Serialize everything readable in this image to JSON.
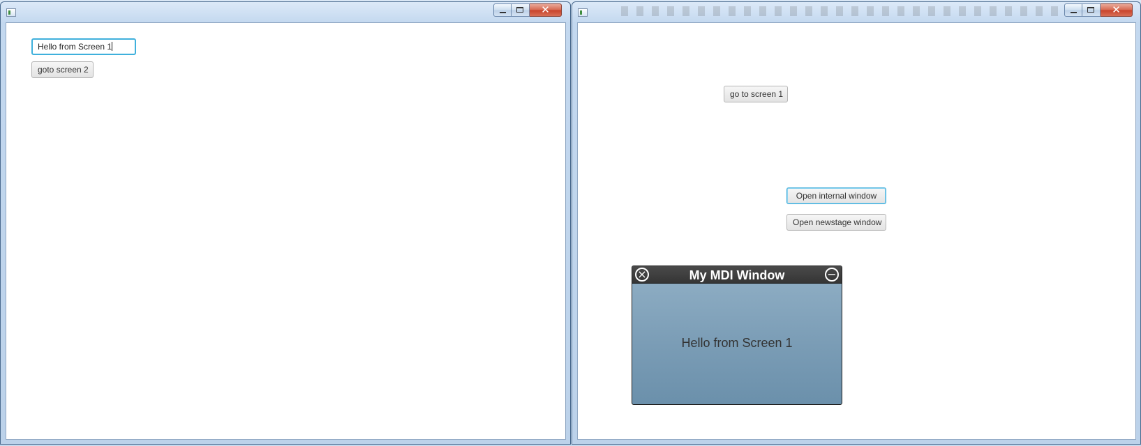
{
  "windows": {
    "left": {
      "text_field_value": "Hello from Screen 1",
      "goto_button_label": "goto screen 2"
    },
    "right": {
      "goto_button_label": "go to screen 1",
      "open_internal_label": "Open internal window",
      "open_newstage_label": "Open newstage window",
      "mdi_window": {
        "title": "My MDI Window",
        "body_text": "Hello from Screen 1",
        "close_icon": "close-circle-icon",
        "minimize_icon": "minimize-circle-icon"
      }
    }
  },
  "window_controls": {
    "minimize_icon": "minimize-icon",
    "maximize_icon": "maximize-icon",
    "close_icon": "close-icon"
  },
  "colors": {
    "focus_accent": "#3fb0dc",
    "mdi_title_bg": "#3b3b3b",
    "mdi_body_bg": "#7b9db6",
    "close_button": "#c8432a"
  }
}
